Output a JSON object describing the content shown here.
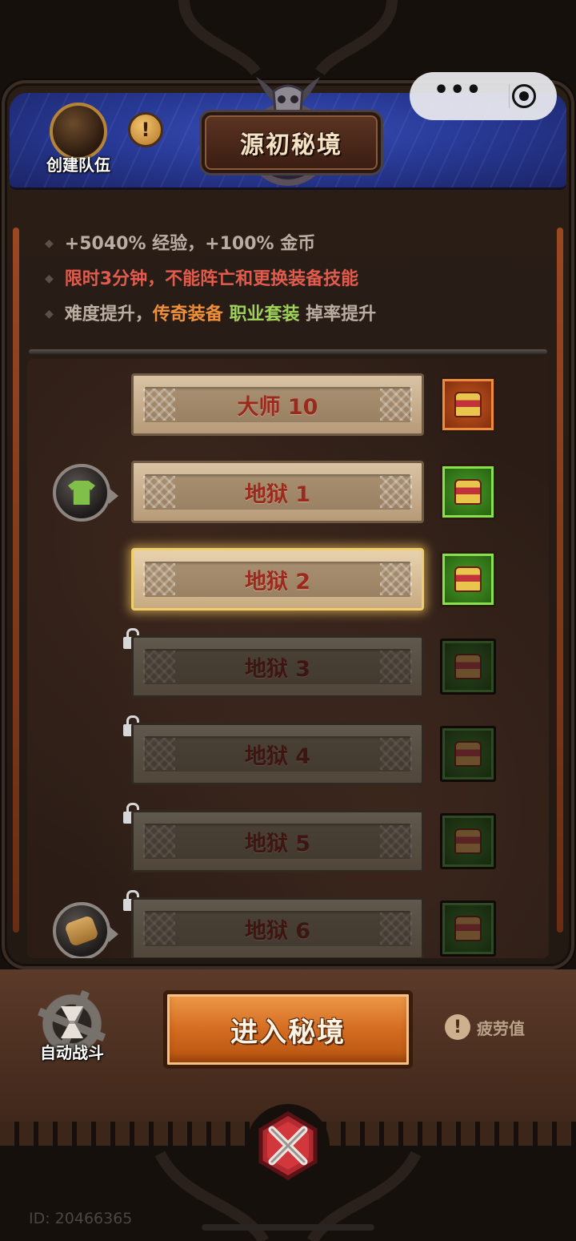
{
  "header": {
    "create_team_label": "创建队伍",
    "info_icon": "!",
    "title": "源初秘境"
  },
  "capsule": {
    "more_icon": "•••",
    "close_icon": "target-icon"
  },
  "info": {
    "line1": "+5040% 经验，+100% 金币",
    "line2": "限时3分钟，不能阵亡和更换装备技能",
    "line3_prefix": "难度提升，",
    "line3_legend": "传奇装备",
    "line3_set": "职业套装",
    "line3_suffix": "掉率提升",
    "accent_red": "#e35b4c",
    "accent_orange": "#ee8f3a",
    "accent_green": "#9fd15a"
  },
  "levels": [
    {
      "label": "大师 10",
      "state": "unlocked",
      "chest": "orange"
    },
    {
      "label": "地狱 1",
      "state": "unlocked",
      "chest": "green",
      "reward": "shirt-icon"
    },
    {
      "label": "地狱 2",
      "state": "selected",
      "chest": "green"
    },
    {
      "label": "地狱 3",
      "state": "locked",
      "chest": "dark"
    },
    {
      "label": "地狱 4",
      "state": "locked",
      "chest": "dark"
    },
    {
      "label": "地狱 5",
      "state": "locked",
      "chest": "dark"
    },
    {
      "label": "地狱 6",
      "state": "locked",
      "chest": "dark",
      "reward": "scroll-icon"
    }
  ],
  "bottom": {
    "auto_battle_label": "自动战斗",
    "enter_label": "进入秘境",
    "fatigue_label": "疲劳值",
    "fatigue_icon": "!"
  },
  "footer": {
    "id_text": "ID: 20466365"
  }
}
